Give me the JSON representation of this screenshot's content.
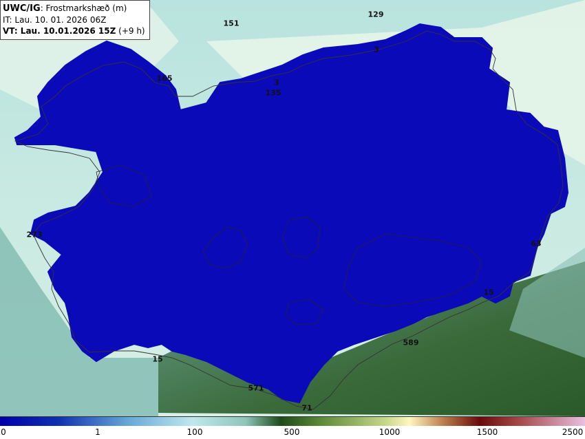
{
  "title": {
    "brand": "UWC/IG",
    "param": ": Frostmarkshæð (m)",
    "initial_time": "IT: Lau. 10. 01. 2026 06Z",
    "valid_time": "VT: Lau. 10.01.2026 15Z",
    "lead": "(+9 h)"
  },
  "point_labels": [
    "151",
    "129",
    "3",
    "165",
    "3",
    "135",
    "273",
    "63",
    "15",
    "589",
    "15",
    "571",
    "71"
  ],
  "colorbar": {
    "ticks": [
      "0",
      "1",
      "100",
      "500",
      "1000",
      "1500",
      "2500"
    ],
    "colors": {
      "zero": "#0000aa",
      "low": "#6aa8d8",
      "mid": "#bfe8ec",
      "green": "#5f8a3a",
      "yellow": "#fff6c0",
      "red": "#6a0a0a",
      "pink": "#e8c0e0"
    }
  }
}
